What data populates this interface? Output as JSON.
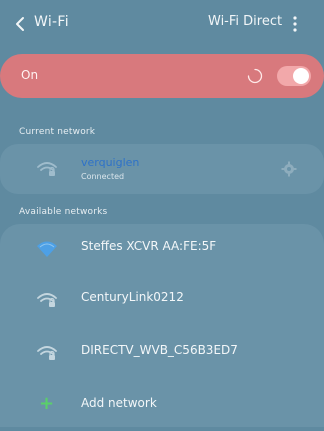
{
  "header": {
    "title": "Wi-Fi",
    "wifi_direct": "Wi-Fi Direct",
    "back_icon": "chevron-left-icon",
    "more_icon": "more-vertical-icon"
  },
  "toggle_bar": {
    "label": "On",
    "enabled": true,
    "accent": "#d8797d"
  },
  "current_network": {
    "section_label": "Current network",
    "name": "verquiglen",
    "status": "Connected",
    "icon": "wifi-lock-icon",
    "settings_icon": "gear-icon"
  },
  "available_networks": {
    "section_label": "Available networks",
    "items": [
      {
        "name": "Steffes XCVR AA:FE:5F",
        "icon": "wifi-icon"
      },
      {
        "name": "CenturyLink0212",
        "icon": "wifi-lock-icon"
      },
      {
        "name": "DIRECTV_WVB_C56B3ED7",
        "icon": "wifi-lock-icon"
      }
    ],
    "add_network": "Add network"
  },
  "colors": {
    "background": "#5f8aa0",
    "card": "#6a93a8",
    "connected_name": "#2e72c8",
    "plus": "#5ad06a"
  }
}
